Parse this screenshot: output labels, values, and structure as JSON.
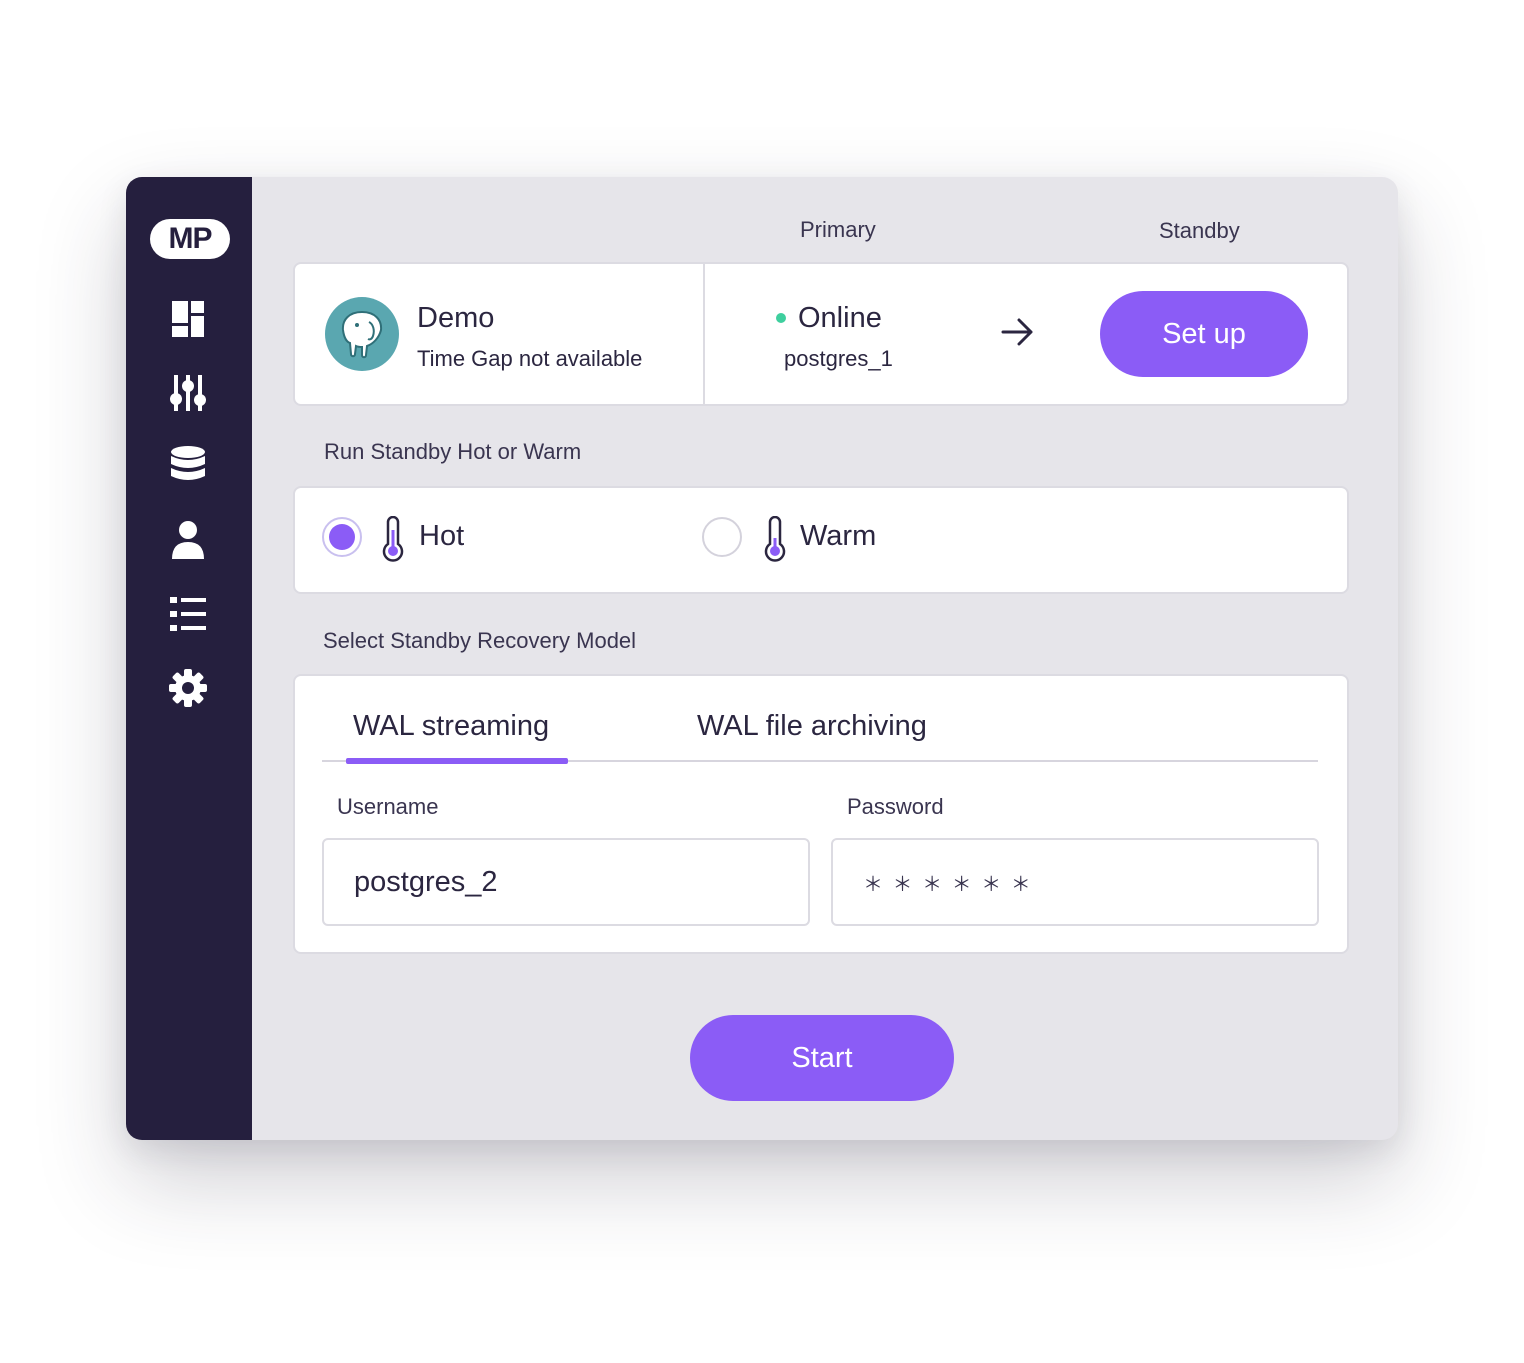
{
  "app": {
    "logo": "MP"
  },
  "sidebar": {
    "items": [
      {
        "icon": "dashboard-icon"
      },
      {
        "icon": "sliders-icon"
      },
      {
        "icon": "database-icon"
      },
      {
        "icon": "user-icon"
      },
      {
        "icon": "list-icon"
      },
      {
        "icon": "gear-icon"
      }
    ]
  },
  "header": {
    "primary_label": "Primary",
    "standby_label": "Standby"
  },
  "instance": {
    "name": "Demo",
    "time_gap": "Time Gap not available",
    "icon": "postgres-elephant-icon",
    "status": "Online",
    "status_color": "#3ecf9e",
    "primary_host": "postgres_1",
    "setup_label": "Set up"
  },
  "mode": {
    "label": "Run Standby Hot or Warm",
    "options": [
      {
        "label": "Hot",
        "selected": true
      },
      {
        "label": "Warm",
        "selected": false
      }
    ]
  },
  "recovery": {
    "label": "Select Standby Recovery Model",
    "tabs": [
      {
        "label": "WAL streaming",
        "active": true
      },
      {
        "label": "WAL file archiving",
        "active": false
      }
    ],
    "username_label": "Username",
    "username_value": "postgres_2",
    "password_label": "Password",
    "password_value": "＊ ＊ ＊ ＊ ＊ ＊"
  },
  "actions": {
    "start_label": "Start"
  },
  "colors": {
    "accent": "#8b5cf6",
    "sidebar": "#251f3e",
    "teal": "#5aa7b0"
  }
}
